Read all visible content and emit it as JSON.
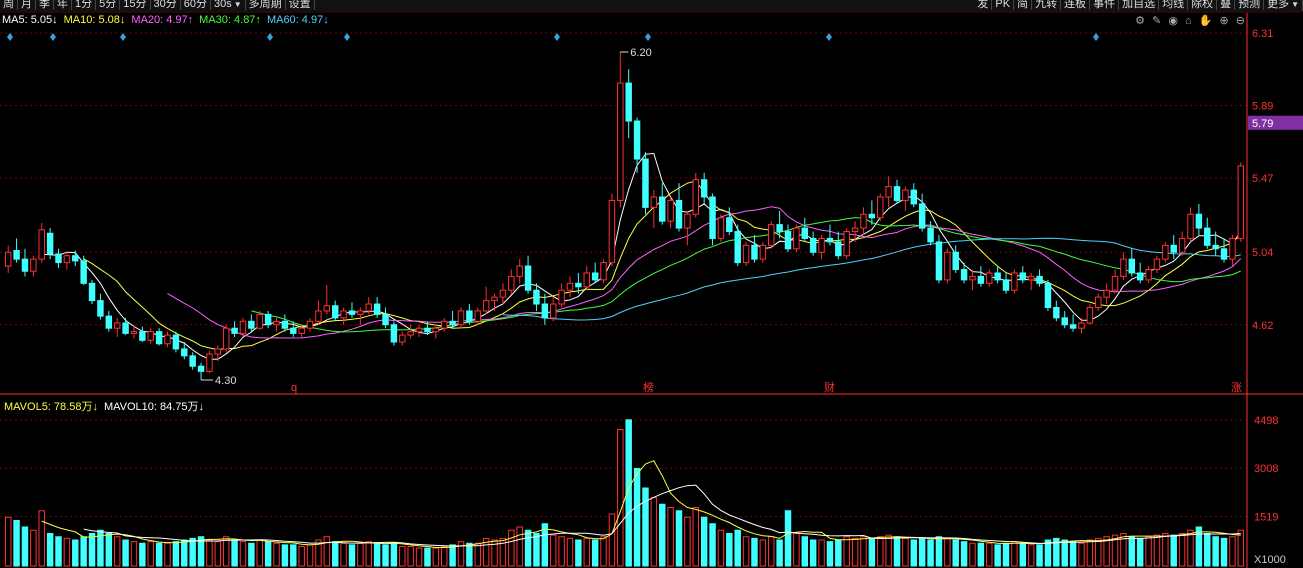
{
  "toolbar": {
    "left": [
      "周",
      "月",
      "季",
      "年",
      "1分",
      "5分",
      "15分",
      "30分",
      "60分",
      "30s",
      "多周期",
      "设置"
    ],
    "right": [
      "发",
      "PK",
      "简",
      "九转",
      "连板",
      "事件",
      "加自选",
      "均线",
      "除权",
      "叠",
      "预测",
      "更多"
    ]
  },
  "ma_legend": [
    {
      "text": "MA5: 5.05↓",
      "color": "#ffffff"
    },
    {
      "text": "MA10: 5.08↓",
      "color": "#ffff40"
    },
    {
      "text": "MA20: 4.97↑",
      "color": "#ff60ff"
    },
    {
      "text": "MA30: 4.87↑",
      "color": "#40ff40"
    },
    {
      "text": "MA60: 4.97↓",
      "color": "#50d0ff"
    }
  ],
  "chart_tools": [
    "gear-icon",
    "pen-icon",
    "eye-icon",
    "lock-icon",
    "hand-icon",
    "zoom-in-icon",
    "zoom-out-icon"
  ],
  "vol_legend": [
    {
      "text": "MAVOL5: 78.58万↓",
      "color": "#ffff40"
    },
    {
      "text": "MAVOL10: 84.75万↓",
      "color": "#ffffff"
    }
  ],
  "price_axis": {
    "ticks": [
      "6.31",
      "5.89",
      "5.47",
      "5.04",
      "4.62"
    ],
    "current": "5.79"
  },
  "vol_axis": {
    "ticks": [
      "4498",
      "3008",
      "1519"
    ],
    "unit": "X1000"
  },
  "annotations": {
    "high": "6.20",
    "low": "4.30"
  },
  "event_markers": [
    "q",
    "榜",
    "财",
    "涨"
  ],
  "colors": {
    "up": "#ff3030",
    "down": "#40ffff",
    "grid": "#7a0000",
    "axis": "#ff3030"
  },
  "chart_data": {
    "type": "candlestick",
    "series_summary": {
      "high": 6.2,
      "low": 4.3,
      "ylim": [
        4.3,
        6.31
      ],
      "vol_ylim": [
        0,
        4800
      ]
    },
    "candles": [
      [
        4.96,
        5.08,
        4.92,
        5.04,
        1500
      ],
      [
        5.05,
        5.12,
        4.98,
        5.0,
        1400
      ],
      [
        5.0,
        5.06,
        4.9,
        4.93,
        1200
      ],
      [
        4.93,
        5.02,
        4.9,
        5.0,
        1100
      ],
      [
        5.0,
        5.21,
        4.98,
        5.17,
        1700
      ],
      [
        5.15,
        5.18,
        5.0,
        5.03,
        1000
      ],
      [
        5.03,
        5.06,
        4.95,
        4.98,
        900
      ],
      [
        4.98,
        5.04,
        4.94,
        5.02,
        850
      ],
      [
        5.02,
        5.05,
        4.96,
        4.99,
        800
      ],
      [
        4.99,
        5.02,
        4.85,
        4.86,
        900
      ],
      [
        4.86,
        4.88,
        4.74,
        4.76,
        1000
      ],
      [
        4.76,
        4.8,
        4.65,
        4.67,
        1100
      ],
      [
        4.67,
        4.7,
        4.58,
        4.6,
        1000
      ],
      [
        4.6,
        4.66,
        4.55,
        4.63,
        900
      ],
      [
        4.63,
        4.66,
        4.56,
        4.57,
        800
      ],
      [
        4.57,
        4.62,
        4.54,
        4.58,
        750
      ],
      [
        4.58,
        4.61,
        4.52,
        4.53,
        700
      ],
      [
        4.53,
        4.6,
        4.51,
        4.58,
        750
      ],
      [
        4.58,
        4.6,
        4.5,
        4.51,
        700
      ],
      [
        4.51,
        4.58,
        4.49,
        4.56,
        700
      ],
      [
        4.56,
        4.58,
        4.46,
        4.48,
        750
      ],
      [
        4.48,
        4.52,
        4.42,
        4.44,
        800
      ],
      [
        4.44,
        4.46,
        4.36,
        4.38,
        850
      ],
      [
        4.38,
        4.4,
        4.3,
        4.35,
        900
      ],
      [
        4.35,
        4.47,
        4.34,
        4.45,
        800
      ],
      [
        4.45,
        4.5,
        4.41,
        4.48,
        750
      ],
      [
        4.48,
        4.62,
        4.46,
        4.6,
        900
      ],
      [
        4.6,
        4.64,
        4.55,
        4.57,
        800
      ],
      [
        4.57,
        4.66,
        4.55,
        4.64,
        750
      ],
      [
        4.64,
        4.68,
        4.58,
        4.6,
        700
      ],
      [
        4.6,
        4.7,
        4.59,
        4.68,
        800
      ],
      [
        4.68,
        4.7,
        4.6,
        4.62,
        750
      ],
      [
        4.62,
        4.66,
        4.58,
        4.64,
        700
      ],
      [
        4.64,
        4.68,
        4.58,
        4.6,
        650
      ],
      [
        4.6,
        4.64,
        4.55,
        4.57,
        650
      ],
      [
        4.57,
        4.62,
        4.54,
        4.6,
        600
      ],
      [
        4.6,
        4.66,
        4.58,
        4.64,
        650
      ],
      [
        4.64,
        4.76,
        4.62,
        4.7,
        800
      ],
      [
        4.7,
        4.85,
        4.68,
        4.73,
        900
      ],
      [
        4.73,
        4.76,
        4.64,
        4.66,
        750
      ],
      [
        4.66,
        4.72,
        4.62,
        4.7,
        700
      ],
      [
        4.7,
        4.75,
        4.66,
        4.68,
        650
      ],
      [
        4.68,
        4.72,
        4.62,
        4.7,
        700
      ],
      [
        4.7,
        4.78,
        4.68,
        4.74,
        750
      ],
      [
        4.74,
        4.78,
        4.66,
        4.68,
        700
      ],
      [
        4.68,
        4.72,
        4.6,
        4.62,
        650
      ],
      [
        4.62,
        4.64,
        4.5,
        4.52,
        700
      ],
      [
        4.52,
        4.58,
        4.5,
        4.56,
        600
      ],
      [
        4.56,
        4.62,
        4.54,
        4.58,
        600
      ],
      [
        4.58,
        4.62,
        4.55,
        4.6,
        550
      ],
      [
        4.6,
        4.64,
        4.56,
        4.58,
        550
      ],
      [
        4.58,
        4.62,
        4.54,
        4.6,
        550
      ],
      [
        4.6,
        4.66,
        4.58,
        4.64,
        600
      ],
      [
        4.64,
        4.7,
        4.6,
        4.62,
        650
      ],
      [
        4.62,
        4.72,
        4.6,
        4.7,
        750
      ],
      [
        4.7,
        4.74,
        4.62,
        4.64,
        700
      ],
      [
        4.64,
        4.72,
        4.62,
        4.7,
        700
      ],
      [
        4.7,
        4.84,
        4.68,
        4.76,
        850
      ],
      [
        4.76,
        4.8,
        4.7,
        4.78,
        800
      ],
      [
        4.78,
        4.86,
        4.74,
        4.82,
        850
      ],
      [
        4.82,
        4.94,
        4.8,
        4.9,
        1100
      ],
      [
        4.9,
        5.0,
        4.86,
        4.96,
        1200
      ],
      [
        4.96,
        5.02,
        4.8,
        4.82,
        1100
      ],
      [
        4.82,
        4.86,
        4.7,
        4.74,
        1000
      ],
      [
        4.74,
        4.8,
        4.62,
        4.66,
        1300
      ],
      [
        4.66,
        4.78,
        4.64,
        4.74,
        950
      ],
      [
        4.74,
        4.86,
        4.72,
        4.82,
        900
      ],
      [
        4.82,
        4.9,
        4.78,
        4.86,
        850
      ],
      [
        4.86,
        4.92,
        4.8,
        4.84,
        800
      ],
      [
        4.84,
        4.96,
        4.82,
        4.92,
        850
      ],
      [
        4.92,
        4.98,
        4.86,
        4.88,
        800
      ],
      [
        4.88,
        5.0,
        4.86,
        4.98,
        900
      ],
      [
        4.98,
        5.38,
        4.96,
        5.34,
        1600
      ],
      [
        5.34,
        6.2,
        5.3,
        6.02,
        4200
      ],
      [
        6.02,
        6.1,
        5.7,
        5.8,
        4498
      ],
      [
        5.8,
        5.82,
        5.5,
        5.58,
        3000
      ],
      [
        5.58,
        5.62,
        5.26,
        5.3,
        2400
      ],
      [
        5.3,
        5.4,
        5.18,
        5.36,
        2100
      ],
      [
        5.36,
        5.44,
        5.2,
        5.22,
        1900
      ],
      [
        5.22,
        5.36,
        5.18,
        5.34,
        1800
      ],
      [
        5.34,
        5.44,
        5.16,
        5.18,
        1700
      ],
      [
        5.18,
        5.28,
        5.08,
        5.26,
        1500
      ],
      [
        5.26,
        5.5,
        5.24,
        5.46,
        1800
      ],
      [
        5.46,
        5.5,
        5.32,
        5.36,
        1500
      ],
      [
        5.36,
        5.38,
        5.08,
        5.12,
        1300
      ],
      [
        5.12,
        5.26,
        5.1,
        5.24,
        1100
      ],
      [
        5.24,
        5.3,
        5.14,
        5.16,
        1000
      ],
      [
        5.16,
        5.2,
        4.96,
        4.98,
        1100
      ],
      [
        4.98,
        5.1,
        4.96,
        5.08,
        900
      ],
      [
        5.08,
        5.14,
        4.98,
        5.0,
        850
      ],
      [
        5.0,
        5.1,
        4.98,
        5.08,
        800
      ],
      [
        5.08,
        5.22,
        5.06,
        5.2,
        900
      ],
      [
        5.2,
        5.28,
        5.12,
        5.16,
        800
      ],
      [
        5.16,
        5.2,
        5.04,
        5.06,
        1700
      ],
      [
        5.06,
        5.2,
        5.04,
        5.18,
        1000
      ],
      [
        5.18,
        5.24,
        5.1,
        5.12,
        900
      ],
      [
        5.12,
        5.16,
        5.02,
        5.04,
        800
      ],
      [
        5.04,
        5.14,
        5.0,
        5.12,
        800
      ],
      [
        5.12,
        5.2,
        5.08,
        5.1,
        750
      ],
      [
        5.1,
        5.16,
        5.0,
        5.02,
        800
      ],
      [
        5.02,
        5.18,
        5.0,
        5.16,
        900
      ],
      [
        5.16,
        5.22,
        5.1,
        5.18,
        850
      ],
      [
        5.18,
        5.3,
        5.14,
        5.26,
        900
      ],
      [
        5.26,
        5.34,
        5.2,
        5.24,
        850
      ],
      [
        5.24,
        5.38,
        5.22,
        5.36,
        900
      ],
      [
        5.36,
        5.48,
        5.3,
        5.42,
        950
      ],
      [
        5.42,
        5.46,
        5.32,
        5.34,
        900
      ],
      [
        5.34,
        5.42,
        5.28,
        5.4,
        850
      ],
      [
        5.4,
        5.44,
        5.3,
        5.32,
        800
      ],
      [
        5.32,
        5.38,
        5.16,
        5.18,
        850
      ],
      [
        5.18,
        5.22,
        5.08,
        5.1,
        800
      ],
      [
        5.1,
        5.14,
        4.86,
        4.88,
        900
      ],
      [
        4.88,
        5.06,
        4.86,
        5.04,
        850
      ],
      [
        5.04,
        5.08,
        4.92,
        4.94,
        800
      ],
      [
        4.94,
        4.98,
        4.86,
        4.88,
        750
      ],
      [
        4.88,
        4.94,
        4.82,
        4.9,
        700
      ],
      [
        4.9,
        4.96,
        4.84,
        4.86,
        700
      ],
      [
        4.86,
        4.94,
        4.84,
        4.92,
        700
      ],
      [
        4.92,
        4.96,
        4.86,
        4.88,
        650
      ],
      [
        4.88,
        4.92,
        4.8,
        4.82,
        700
      ],
      [
        4.82,
        4.94,
        4.8,
        4.92,
        750
      ],
      [
        4.92,
        4.96,
        4.86,
        4.88,
        700
      ],
      [
        4.88,
        4.92,
        4.82,
        4.9,
        650
      ],
      [
        4.9,
        4.94,
        4.84,
        4.86,
        650
      ],
      [
        4.86,
        4.88,
        4.7,
        4.72,
        800
      ],
      [
        4.72,
        4.76,
        4.64,
        4.66,
        850
      ],
      [
        4.66,
        4.7,
        4.6,
        4.62,
        800
      ],
      [
        4.62,
        4.68,
        4.58,
        4.6,
        750
      ],
      [
        4.6,
        4.66,
        4.57,
        4.63,
        700
      ],
      [
        4.63,
        4.74,
        4.62,
        4.72,
        800
      ],
      [
        4.72,
        4.8,
        4.7,
        4.78,
        850
      ],
      [
        4.78,
        4.86,
        4.74,
        4.82,
        900
      ],
      [
        4.82,
        4.94,
        4.8,
        4.9,
        950
      ],
      [
        4.9,
        5.04,
        4.88,
        5.0,
        1000
      ],
      [
        5.0,
        5.06,
        4.9,
        4.92,
        900
      ],
      [
        4.92,
        4.98,
        4.86,
        4.88,
        850
      ],
      [
        4.88,
        4.96,
        4.86,
        4.94,
        900
      ],
      [
        4.94,
        5.02,
        4.92,
        5.0,
        950
      ],
      [
        5.0,
        5.1,
        4.98,
        5.08,
        1000
      ],
      [
        5.08,
        5.14,
        5.0,
        5.04,
        950
      ],
      [
        5.04,
        5.16,
        5.02,
        5.12,
        1000
      ],
      [
        5.12,
        5.3,
        5.1,
        5.26,
        1100
      ],
      [
        5.26,
        5.32,
        5.14,
        5.18,
        1200
      ],
      [
        5.18,
        5.24,
        5.06,
        5.08,
        1000
      ],
      [
        5.08,
        5.16,
        5.02,
        5.06,
        900
      ],
      [
        5.06,
        5.12,
        4.98,
        5.0,
        850
      ],
      [
        5.0,
        5.14,
        4.96,
        5.12,
        900
      ],
      [
        5.12,
        5.56,
        5.1,
        5.54,
        1100
      ]
    ]
  }
}
